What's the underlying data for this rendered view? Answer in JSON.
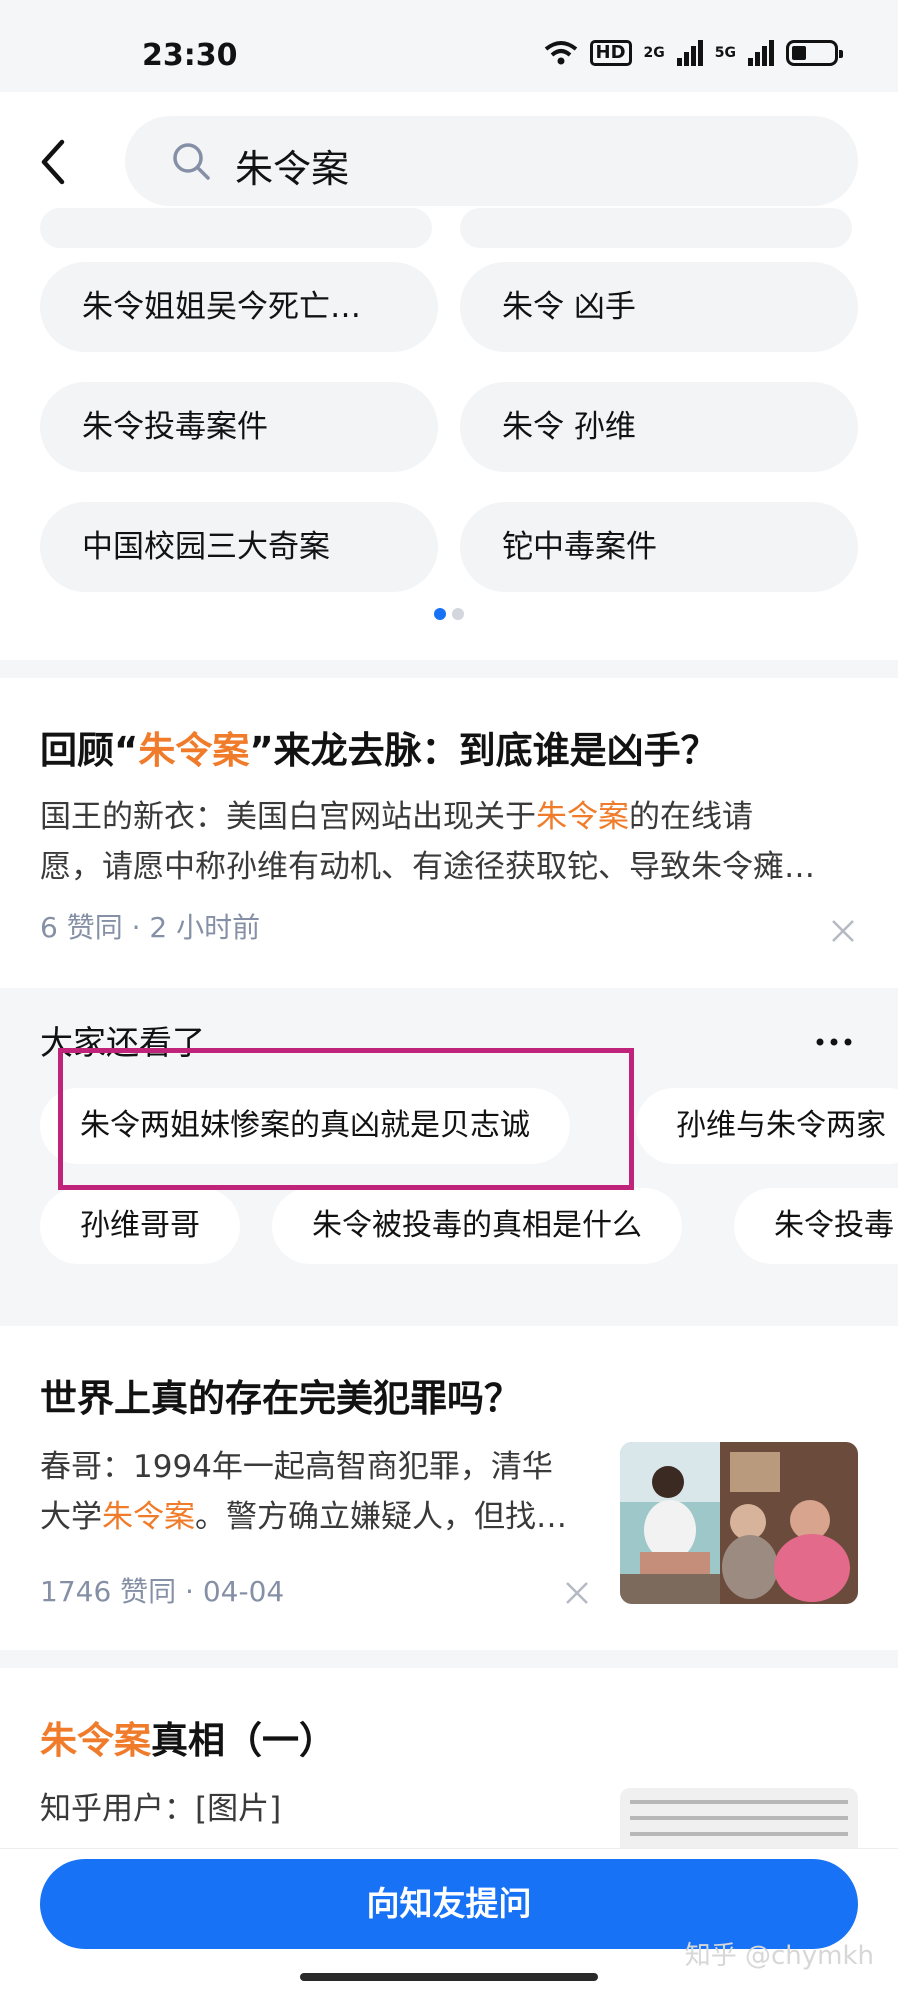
{
  "status_bar": {
    "time": "23:30",
    "hd": "HD",
    "net1": "2G",
    "net2": "5G"
  },
  "search": {
    "query": "朱令案"
  },
  "suggestions": [
    "朱令姐姐吴今死亡…",
    "朱令 凶手",
    "朱令投毒案件",
    "朱令 孙维",
    "中国校园三大奇案",
    "铊中毒案件"
  ],
  "article1": {
    "title_pre": "回顾“",
    "title_hl": "朱令案",
    "title_post": "”来龙去脉：到底谁是凶手？",
    "excerpt_pre": "国王的新衣：美国白宫网站出现关于",
    "excerpt_hl": "朱令案",
    "excerpt_post1": "的在线请",
    "excerpt_line2": "愿，请愿中称孙维有动机、有途径获取铊、导致朱令瘫…",
    "meta": "6 赞同 · 2 小时前"
  },
  "related": {
    "title": "大家还看了",
    "chips_row1": [
      "朱令两姐妹惨案的真凶就是贝志诚",
      "孙维与朱令两家"
    ],
    "chips_row2": [
      "孙维哥哥",
      "朱令被投毒的真相是什么",
      "朱令投毒"
    ]
  },
  "article2": {
    "title": "世界上真的存在完美犯罪吗？",
    "excerpt_line1": "春哥：1994年一起高智商犯罪，清华",
    "excerpt_line2_pre": "大学",
    "excerpt_line2_hl": "朱令案",
    "excerpt_line2_post": "。警方确立嫌疑人，但找…",
    "meta": "1746 赞同 · 04-04"
  },
  "article3": {
    "title_hl": "朱令案",
    "title_post": "真相（一）",
    "excerpt": "知乎用户：[图片]"
  },
  "bottom": {
    "ask_label": "向知友提问",
    "watermark": "知乎 @chymkh"
  },
  "colors": {
    "accent": "#1772f6",
    "highlight": "#f07c2b",
    "box": "#c0247a"
  }
}
